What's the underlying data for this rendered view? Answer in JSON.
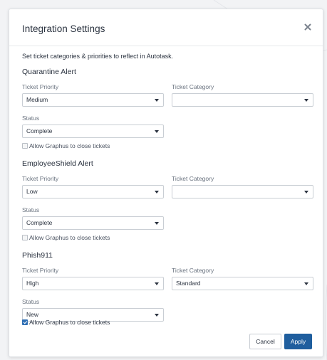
{
  "modal": {
    "title": "Integration Settings",
    "intro": "Set ticket categories & priorities to reflect in Autotask."
  },
  "labels": {
    "priority": "Ticket Priority",
    "category": "Ticket Category",
    "status": "Status",
    "allow_close": "Allow Graphus to close tickets"
  },
  "sections": [
    {
      "title": "Quarantine Alert",
      "priority": "Medium",
      "category": "",
      "status": "Complete",
      "allow_close": false
    },
    {
      "title": "EmployeeShield Alert",
      "priority": "Low",
      "category": "",
      "status": "Complete",
      "allow_close": false
    },
    {
      "title": "Phish911",
      "priority": "High",
      "category": "Standard",
      "status": "New",
      "allow_close": true
    }
  ],
  "footer": {
    "cancel_label": "Cancel",
    "apply_label": "Apply"
  },
  "colors": {
    "primary": "#1f5e9e",
    "checkbox_checked": "#2f6fb4"
  },
  "icons": {
    "close": "close-icon",
    "dropdown": "chevron-down-icon"
  }
}
